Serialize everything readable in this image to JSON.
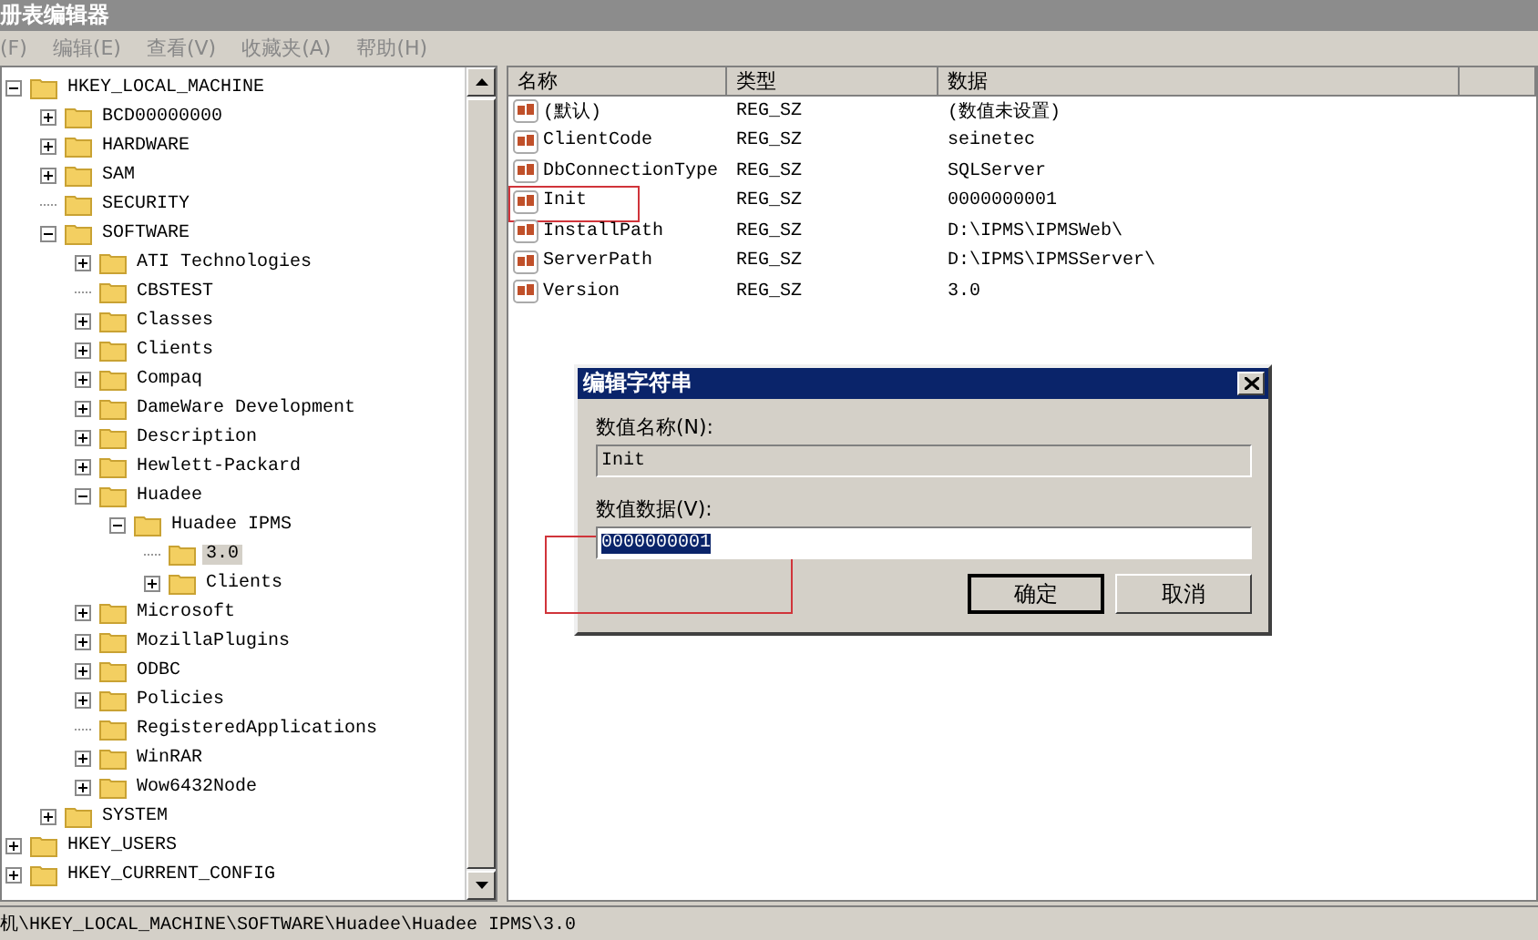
{
  "window": {
    "title": "册表编辑器"
  },
  "menu": [
    {
      "label": "(F)"
    },
    {
      "label": "编辑(E)"
    },
    {
      "label": "查看(V)"
    },
    {
      "label": "收藏夹(A)"
    },
    {
      "label": "帮助(H)"
    }
  ],
  "tree": [
    {
      "label": "HKEY_LOCAL_MACHINE",
      "has_subkeys": true,
      "expanded": true,
      "selected": false,
      "children": [
        {
          "label": "BCD00000000",
          "has_subkeys": true,
          "expanded": false,
          "selected": false
        },
        {
          "label": "HARDWARE",
          "has_subkeys": true,
          "expanded": false,
          "selected": false
        },
        {
          "label": "SAM",
          "has_subkeys": true,
          "expanded": false,
          "selected": false
        },
        {
          "label": "SECURITY",
          "has_subkeys": false,
          "selected": false
        },
        {
          "label": "SOFTWARE",
          "has_subkeys": true,
          "expanded": true,
          "selected": false,
          "children": [
            {
              "label": "ATI Technologies",
              "has_subkeys": true,
              "expanded": false,
              "selected": false
            },
            {
              "label": "CBSTEST",
              "has_subkeys": false,
              "selected": false
            },
            {
              "label": "Classes",
              "has_subkeys": true,
              "expanded": false,
              "selected": false
            },
            {
              "label": "Clients",
              "has_subkeys": true,
              "expanded": false,
              "selected": false
            },
            {
              "label": "Compaq",
              "has_subkeys": true,
              "expanded": false,
              "selected": false
            },
            {
              "label": "DameWare Development",
              "has_subkeys": true,
              "expanded": false,
              "selected": false
            },
            {
              "label": "Description",
              "has_subkeys": true,
              "expanded": false,
              "selected": false
            },
            {
              "label": "Hewlett-Packard",
              "has_subkeys": true,
              "expanded": false,
              "selected": false
            },
            {
              "label": "Huadee",
              "has_subkeys": true,
              "expanded": true,
              "selected": false,
              "children": [
                {
                  "label": "Huadee IPMS",
                  "has_subkeys": true,
                  "expanded": true,
                  "selected": false,
                  "children": [
                    {
                      "label": "3.0",
                      "has_subkeys": false,
                      "selected": true
                    },
                    {
                      "label": "Clients",
                      "has_subkeys": true,
                      "expanded": false,
                      "selected": false
                    }
                  ]
                }
              ]
            },
            {
              "label": "Microsoft",
              "has_subkeys": true,
              "expanded": false,
              "selected": false
            },
            {
              "label": "MozillaPlugins",
              "has_subkeys": true,
              "expanded": false,
              "selected": false
            },
            {
              "label": "ODBC",
              "has_subkeys": true,
              "expanded": false,
              "selected": false
            },
            {
              "label": "Policies",
              "has_subkeys": true,
              "expanded": false,
              "selected": false
            },
            {
              "label": "RegisteredApplications",
              "has_subkeys": false,
              "selected": false
            },
            {
              "label": "WinRAR",
              "has_subkeys": true,
              "expanded": false,
              "selected": false
            },
            {
              "label": "Wow6432Node",
              "has_subkeys": true,
              "expanded": false,
              "selected": false
            }
          ]
        },
        {
          "label": "SYSTEM",
          "has_subkeys": true,
          "expanded": false,
          "selected": false
        }
      ]
    },
    {
      "label": "HKEY_USERS",
      "has_subkeys": true,
      "expanded": false,
      "selected": false
    },
    {
      "label": "HKEY_CURRENT_CONFIG",
      "has_subkeys": true,
      "expanded": false,
      "selected": false
    }
  ],
  "values": {
    "columns": [
      "名称",
      "类型",
      "数据"
    ],
    "rows": [
      {
        "name": "(默认)",
        "type": "REG_SZ",
        "data": "(数值未设置)"
      },
      {
        "name": "ClientCode",
        "type": "REG_SZ",
        "data": "seinetec"
      },
      {
        "name": "DbConnectionType",
        "type": "REG_SZ",
        "data": "SQLServer"
      },
      {
        "name": "Init",
        "type": "REG_SZ",
        "data": "0000000001",
        "highlighted": true
      },
      {
        "name": "InstallPath",
        "type": "REG_SZ",
        "data": "D:\\IPMS\\IPMSWeb\\"
      },
      {
        "name": "ServerPath",
        "type": "REG_SZ",
        "data": "D:\\IPMS\\IPMSServer\\"
      },
      {
        "name": "Version",
        "type": "REG_SZ",
        "data": "3.0"
      }
    ]
  },
  "dialog": {
    "title": "编辑字符串",
    "name_label": "数值名称(N):",
    "name_value": "Init",
    "data_label": "数值数据(V):",
    "data_value": "0000000001",
    "data_highlighted": true,
    "buttons": [
      {
        "label": "确定",
        "default": true
      },
      {
        "label": "取消",
        "default": false
      }
    ]
  },
  "status_bar": "机\\HKEY_LOCAL_MACHINE\\SOFTWARE\\Huadee\\Huadee IPMS\\3.0"
}
